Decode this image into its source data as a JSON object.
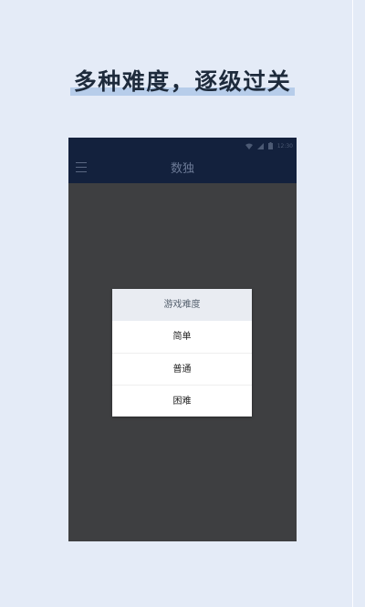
{
  "headline": "多种难度，逐级过关",
  "status_bar": {
    "time": "12:30"
  },
  "app_bar": {
    "title": "数独"
  },
  "dialog": {
    "title": "游戏难度",
    "options": [
      "简单",
      "普通",
      "困难"
    ]
  },
  "colors": {
    "page_background": "#e4ebf7",
    "app_bar": "#13213d",
    "screen_overlay": "#3e3f41",
    "headline_highlight": "#b7cdea"
  }
}
